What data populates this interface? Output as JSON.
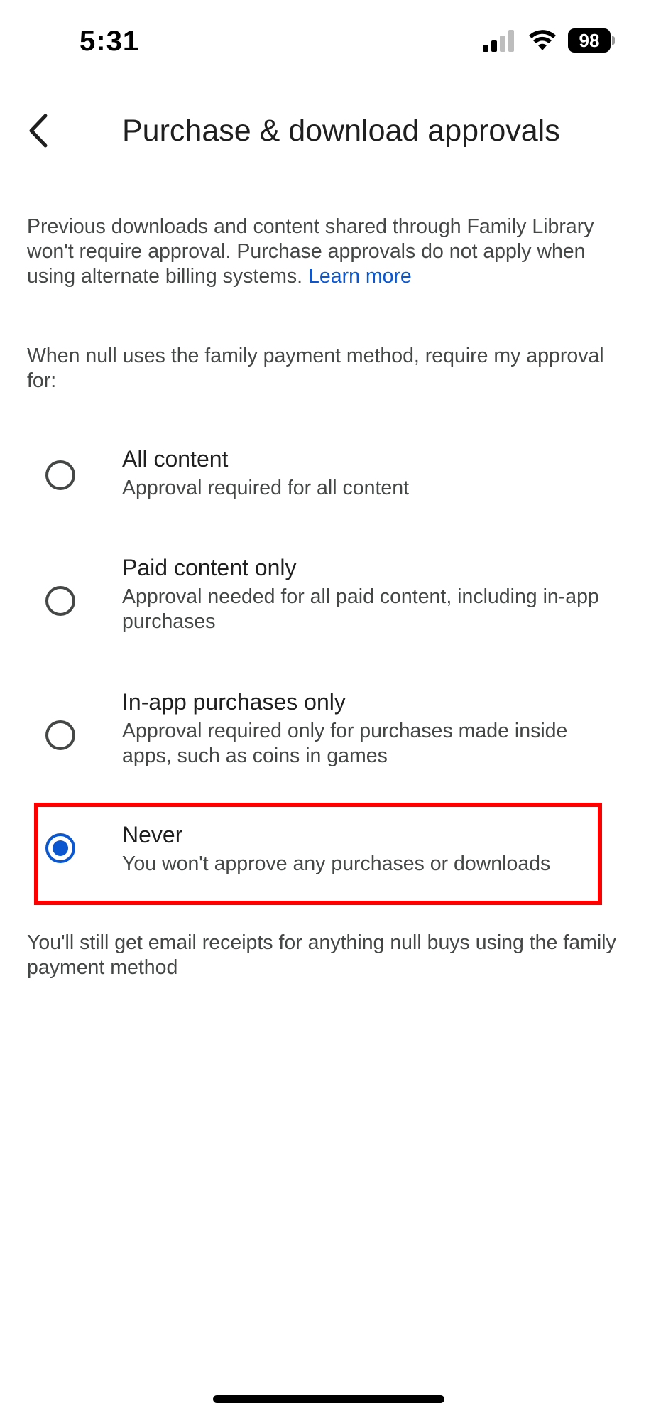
{
  "status_bar": {
    "time": "5:31",
    "battery": "98"
  },
  "header": {
    "title": "Purchase & download approvals"
  },
  "intro": {
    "text": "Previous downloads and content shared through Family Library won't require approval. Purchase approvals do not apply when using alternate billing systems. ",
    "link": "Learn more"
  },
  "prompt": "When null uses the family payment method, require my approval for:",
  "options": [
    {
      "title": "All content",
      "description": "Approval required for all content",
      "selected": false
    },
    {
      "title": "Paid content only",
      "description": "Approval needed for all paid content, including in-app purchases",
      "selected": false
    },
    {
      "title": "In-app purchases only",
      "description": "Approval required only for purchases made inside apps, such as coins in games",
      "selected": false
    },
    {
      "title": "Never",
      "description": "You won't approve any purchases or downloads",
      "selected": true
    }
  ],
  "footer_note": "You'll still get email receipts for anything null buys using the family payment method",
  "colors": {
    "accent": "#0b57d0",
    "highlight": "#ff0000",
    "text_primary": "#1f1f1f",
    "text_secondary": "#444746"
  }
}
